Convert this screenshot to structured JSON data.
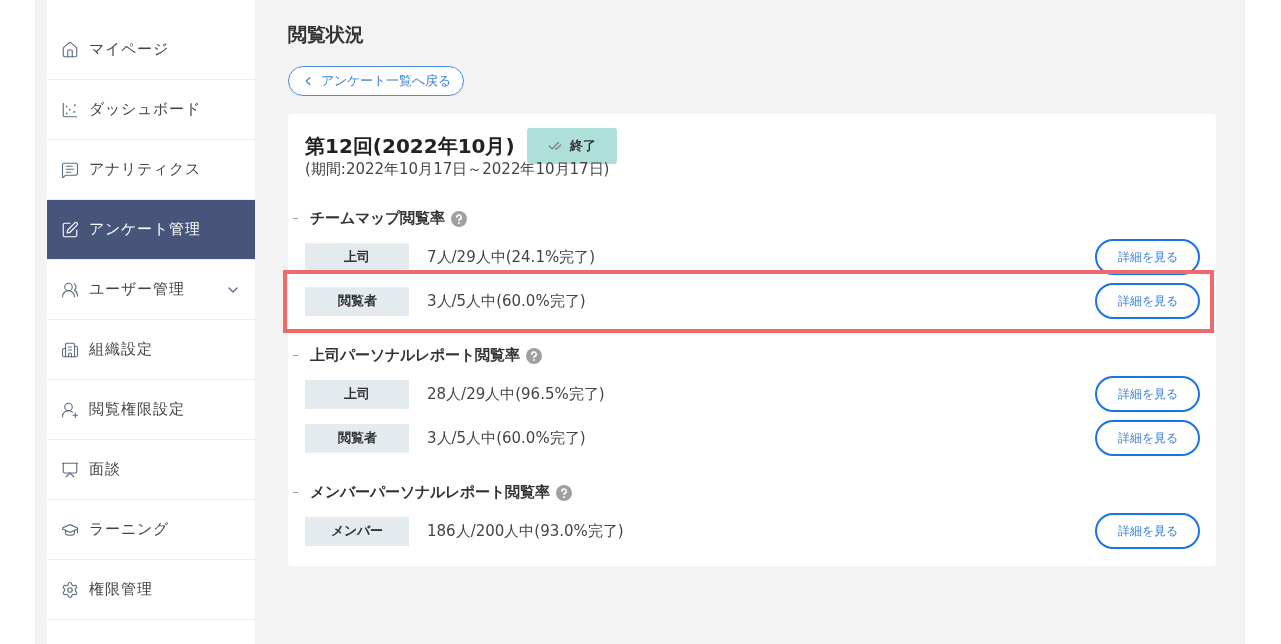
{
  "sidebar": {
    "items": [
      {
        "label": "マイページ",
        "selected": false,
        "has_submenu": false
      },
      {
        "label": "ダッシュボード",
        "selected": false,
        "has_submenu": false
      },
      {
        "label": "アナリティクス",
        "selected": false,
        "has_submenu": false
      },
      {
        "label": "アンケート管理",
        "selected": true,
        "has_submenu": false
      },
      {
        "label": "ユーザー管理",
        "selected": false,
        "has_submenu": true
      },
      {
        "label": "組織設定",
        "selected": false,
        "has_submenu": false
      },
      {
        "label": "閲覧権限設定",
        "selected": false,
        "has_submenu": false
      },
      {
        "label": "面談",
        "selected": false,
        "has_submenu": false
      },
      {
        "label": "ラーニング",
        "selected": false,
        "has_submenu": false
      },
      {
        "label": "権限管理",
        "selected": false,
        "has_submenu": false
      }
    ]
  },
  "page_title": "閲覧状況",
  "back_link": "アンケート一覧へ戻る",
  "survey": {
    "title": "第12回(2022年10月)",
    "status": "終了",
    "period": "(期間:2022年10月17日～2022年10月17日)"
  },
  "sections": [
    {
      "heading": "チームマップ閲覧率",
      "rows": [
        {
          "role": "上司",
          "count": "7人/29人中(24.1%完了)",
          "button": "詳細を見る",
          "highlighted": false
        },
        {
          "role": "閲覧者",
          "count": "3人/5人中(60.0%完了)",
          "button": "詳細を見る",
          "highlighted": true
        }
      ]
    },
    {
      "heading": "上司パーソナルレポート閲覧率",
      "rows": [
        {
          "role": "上司",
          "count": "28人/29人中(96.5%完了)",
          "button": "詳細を見る",
          "highlighted": false
        },
        {
          "role": "閲覧者",
          "count": "3人/5人中(60.0%完了)",
          "button": "詳細を見る",
          "highlighted": false
        }
      ]
    },
    {
      "heading": "メンバーパーソナルレポート閲覧率",
      "rows": [
        {
          "role": "メンバー",
          "count": "186人/200人中(93.0%完了)",
          "button": "詳細を見る",
          "highlighted": false
        }
      ]
    }
  ]
}
